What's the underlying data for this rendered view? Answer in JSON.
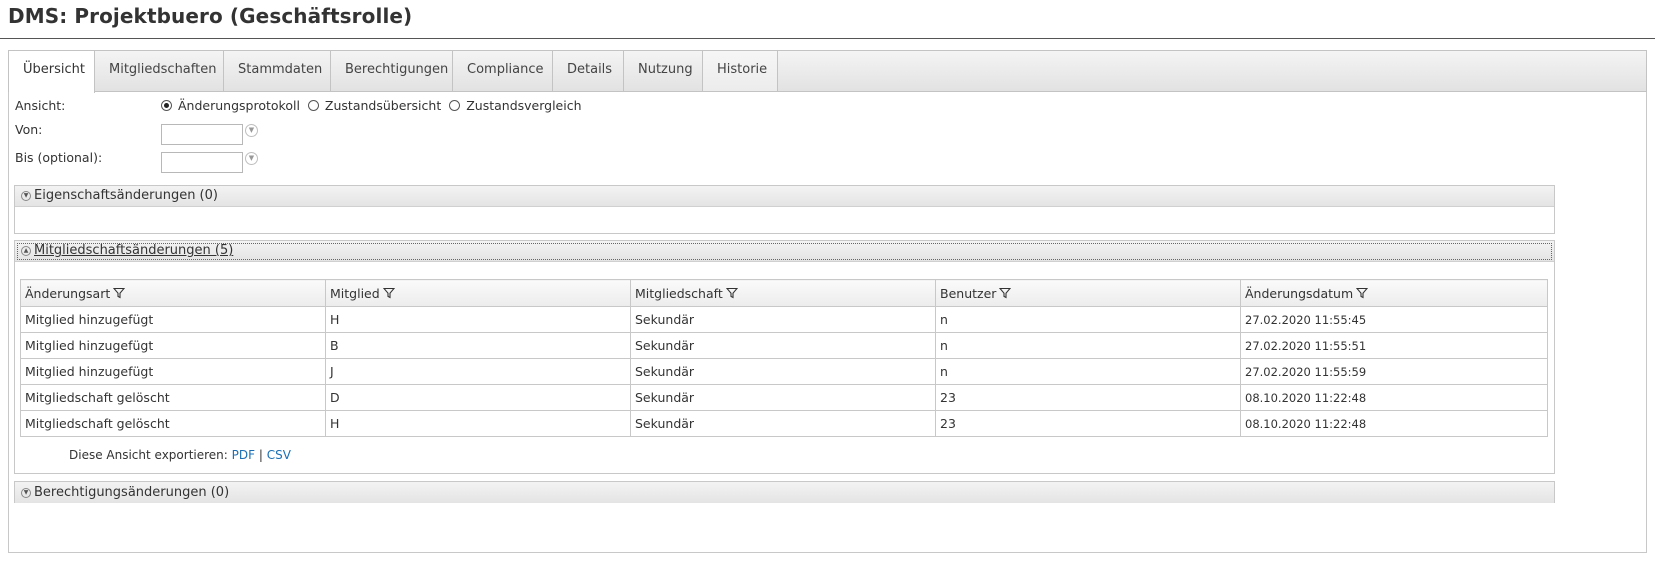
{
  "page": {
    "title": "DMS: Projektbuero (Geschäftsrolle)"
  },
  "tabs": [
    {
      "label": "Übersicht"
    },
    {
      "label": "Mitgliedschaften"
    },
    {
      "label": "Stammdaten"
    },
    {
      "label": "Berechtigungen"
    },
    {
      "label": "Compliance"
    },
    {
      "label": "Details"
    },
    {
      "label": "Nutzung"
    },
    {
      "label": "Historie"
    }
  ],
  "form": {
    "view_label": "Ansicht:",
    "view_options": [
      {
        "label": "Änderungsprotokoll",
        "selected": true
      },
      {
        "label": "Zustandsübersicht",
        "selected": false
      },
      {
        "label": "Zustandsvergleich",
        "selected": false
      }
    ],
    "from_label": "Von:",
    "from_value": "",
    "to_label": "Bis (optional):",
    "to_value": ""
  },
  "sections": {
    "property_changes": {
      "label": "Eigenschaftsänderungen (0)"
    },
    "membership_changes": {
      "label": "Mitgliedschaftsänderungen (5)"
    },
    "permission_changes": {
      "label": "Berechtigungsänderungen (0)"
    }
  },
  "table": {
    "columns": [
      "Änderungsart",
      "Mitglied",
      "Mitgliedschaft",
      "Benutzer",
      "Änderungsdatum"
    ],
    "rows": [
      [
        "Mitglied hinzugefügt",
        "H",
        "Sekundär",
        "n",
        "27.02.2020 11:55:45"
      ],
      [
        "Mitglied hinzugefügt",
        "B",
        "Sekundär",
        "n",
        "27.02.2020 11:55:51"
      ],
      [
        "Mitglied hinzugefügt",
        "J",
        "Sekundär",
        "n",
        "27.02.2020 11:55:59"
      ],
      [
        "Mitgliedschaft gelöscht",
        "D",
        "Sekundär",
        "23",
        "08.10.2020 11:22:48"
      ],
      [
        "Mitgliedschaft gelöscht",
        "H",
        "Sekundär",
        "23",
        "08.10.2020 11:22:48"
      ]
    ]
  },
  "export": {
    "label": "Diese Ansicht exportieren:",
    "pdf": "PDF",
    "separator": "|",
    "csv": "CSV"
  },
  "icons": {
    "filter": "filter-icon",
    "expand": "expand-icon",
    "calendar": "date-picker-icon"
  },
  "colors": {
    "link": "#1a6fb5",
    "border": "#c8c8c8",
    "title_rule": "#555555"
  }
}
